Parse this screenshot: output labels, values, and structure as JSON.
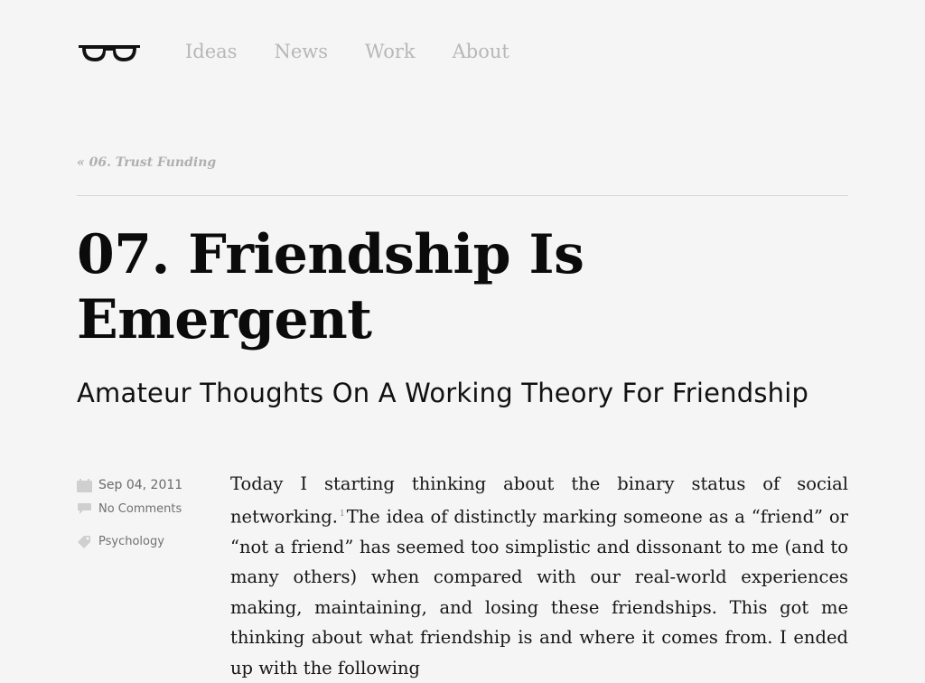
{
  "nav": {
    "logo_icon": "eyeglasses-icon",
    "items": [
      {
        "label": "Ideas"
      },
      {
        "label": "News"
      },
      {
        "label": "Work"
      },
      {
        "label": "About"
      }
    ]
  },
  "post": {
    "prev_link": "« 06. Trust Funding",
    "title": "07. Friendship Is Emergent",
    "subtitle": "Amateur Thoughts On A Working Theory For Friendship",
    "meta": {
      "date": "Sep 04, 2011",
      "comments": "No Comments",
      "category": "Psychology"
    },
    "body_before_fn": "Today I starting thinking about the binary status of social networking.",
    "footnote": "1",
    "body_after_fn": "The idea of distinctly marking someone as a “friend” or “not a friend” has seemed too simplistic and dissonant to me (and to many others) when compared with our real-world experiences making, maintaining, and losing these friendships. This got me thinking about what friendship is and where it comes from. I ended up with the following"
  },
  "colors": {
    "background": "#f5f5f5",
    "nav_text": "#b7b7b7",
    "title": "#0b0b0b",
    "meta_text": "#6e6e6e"
  }
}
